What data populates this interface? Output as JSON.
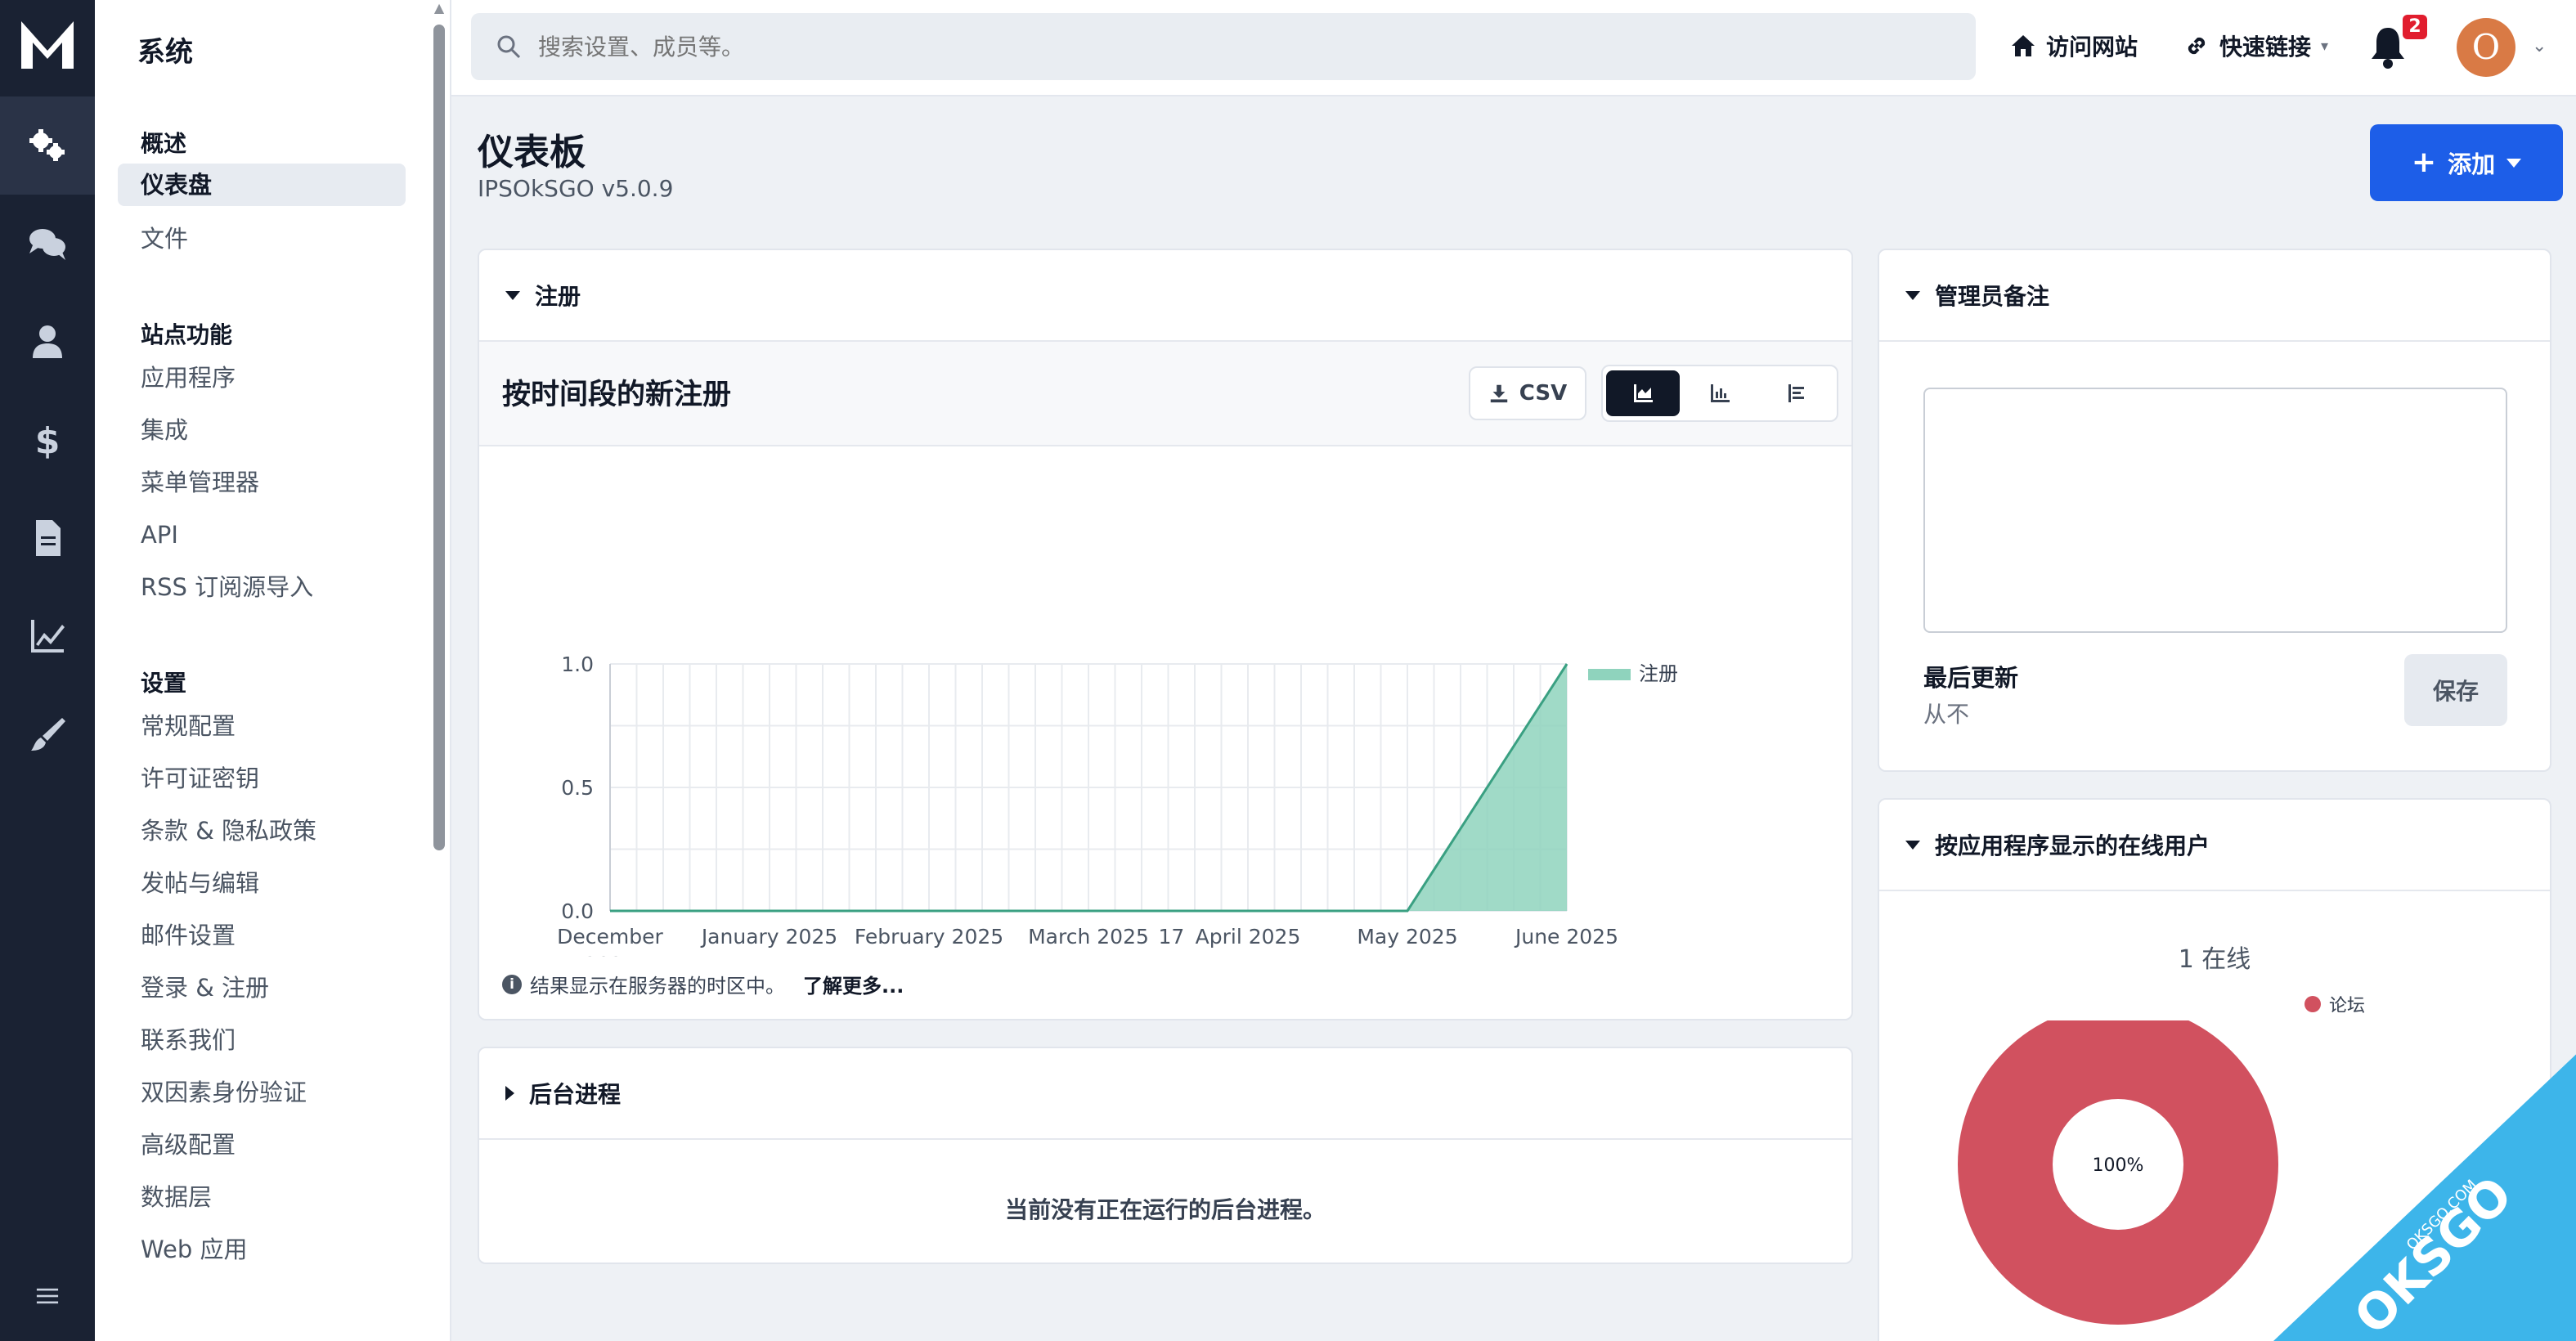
{
  "sidebar": {
    "title": "系统",
    "groups": [
      {
        "label": "概述",
        "items": [
          "仪表盘",
          "文件"
        ]
      },
      {
        "label": "站点功能",
        "items": [
          "应用程序",
          "集成",
          "菜单管理器",
          "API",
          "RSS 订阅源导入"
        ]
      },
      {
        "label": "设置",
        "items": [
          "常规配置",
          "许可证密钥",
          "条款 & 隐私政策",
          "发帖与编辑",
          "邮件设置",
          "登录 & 注册",
          "联系我们",
          "双因素身份验证",
          "高级配置",
          "数据层",
          "Web 应用"
        ]
      }
    ]
  },
  "topbar": {
    "search_placeholder": "搜索设置、成员等。",
    "visit_site": "访问网站",
    "quick_links": "快速链接",
    "notification_count": "2",
    "avatar_letter": "O"
  },
  "header": {
    "title": "仪表板",
    "version": "IPSOkSGO v5.0.9",
    "add_button": "添加"
  },
  "registrations": {
    "section_title": "注册",
    "chart_title": "按时间段的新注册",
    "csv_label": "CSV",
    "timezone_note": "结果显示在服务器的时区中。",
    "learn_more": "了解更多..."
  },
  "chart_data": {
    "type": "area",
    "title": "按时间段的新注册",
    "x_ticks": [
      "December 2024",
      "January 2025",
      "February 2025",
      "March 2025",
      "17",
      "April 2025",
      "May 2025",
      "June 2025"
    ],
    "x": [
      "December 2024",
      "January 2025",
      "February 2025",
      "March 2025",
      "April 2025",
      "May 2025",
      "June 2025"
    ],
    "series": [
      {
        "name": "注册",
        "values": [
          0,
          0,
          0,
          0,
          0,
          0,
          1
        ],
        "color": "#8fd3bd"
      }
    ],
    "ylim": [
      0,
      1.0
    ],
    "y_ticks": [
      "1.0",
      "0.5",
      "0.0"
    ],
    "grid": true,
    "legend": "top-right"
  },
  "background_tasks": {
    "title": "后台进程",
    "empty_message": "当前没有正在运行的后台进程。"
  },
  "admin_notes": {
    "title": "管理员备注",
    "last_updated_label": "最后更新",
    "last_updated_value": "从不",
    "save_button": "保存"
  },
  "online_users": {
    "title": "按应用程序显示的在线用户",
    "count_label": "1 在线",
    "chart": {
      "type": "pie",
      "slices": [
        {
          "label": "论坛",
          "value": 100,
          "color": "#d1515f"
        }
      ],
      "center_label": "100%"
    }
  },
  "colors": {
    "rail_bg": "#1a2233",
    "accent": "#1d5ee8",
    "badge": "#e11d2e"
  },
  "icons": [
    "logo-icon",
    "gears-icon",
    "chat-icon",
    "user-icon",
    "dollar-icon",
    "file-icon",
    "stats-icon",
    "brush-icon",
    "menu-icon"
  ]
}
